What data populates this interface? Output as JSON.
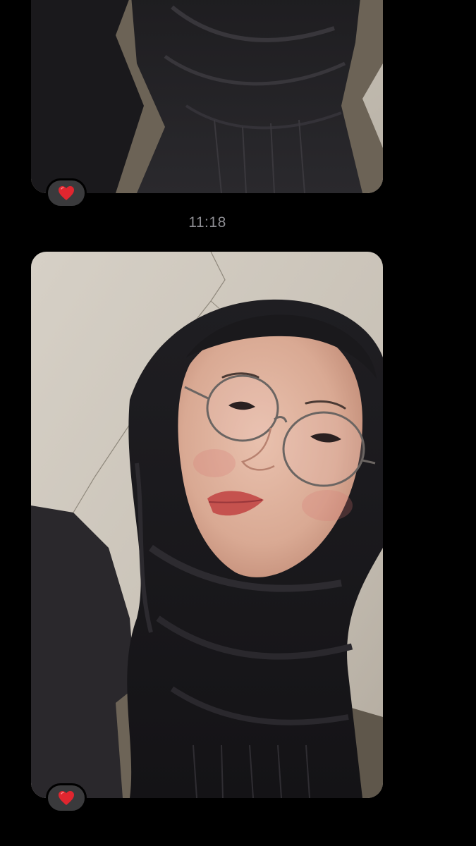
{
  "thread": {
    "messages": [
      {
        "type": "photo",
        "image": "selfie-scarf-crop",
        "reaction": {
          "emoji": "heart-emoji",
          "color": "#e0262f"
        }
      },
      {
        "type": "timestamp",
        "text": "11:18"
      },
      {
        "type": "photo",
        "image": "selfie-hijab-glasses",
        "reaction": {
          "emoji": "heart-emoji",
          "color": "#e0262f"
        }
      }
    ]
  },
  "colors": {
    "background": "#000000",
    "reaction_pill": "#3a3a3c",
    "timestamp_text": "#8e8e93",
    "heart": "#e0262f"
  }
}
